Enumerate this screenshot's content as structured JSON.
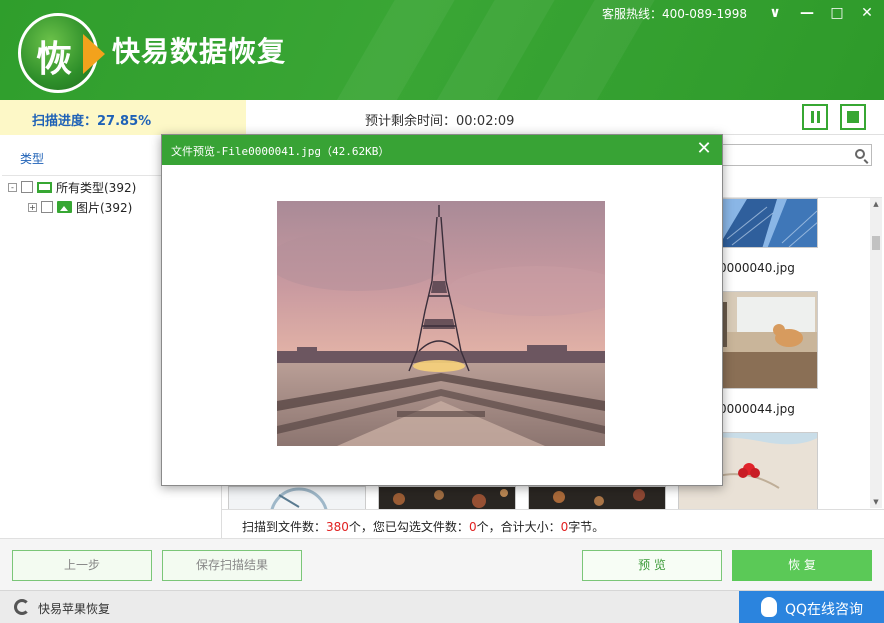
{
  "header": {
    "logo_char": "恢",
    "app_title": "快易数据恢复",
    "hotline": "客服热线：400-089-1998",
    "window_buttons": {
      "menu": "∨",
      "minimize": "—",
      "maximize": "□",
      "close": "✕"
    }
  },
  "scan": {
    "progress_label": "扫描进度：27.85%",
    "progress_fraction": 0.2785,
    "remaining_label": "预计剩余时间：00:02:09"
  },
  "left_panel": {
    "header": "类型",
    "tree": [
      {
        "label": "所有类型(392)",
        "expander": "-",
        "icon": "computer-icon"
      },
      {
        "label": "图片(392)",
        "expander": "+",
        "icon": "image-icon"
      }
    ]
  },
  "grid": {
    "files": [
      {
        "name": "0000040.jpg"
      },
      {
        "name": "0000044.jpg"
      }
    ]
  },
  "status": {
    "prefix": "扫描到文件数：",
    "scanned_count": "380",
    "mid1": "个，您已勾选文件数：",
    "selected_count": "0",
    "mid2": "个，合计大小：",
    "total_size": "0",
    "suffix": "字节。"
  },
  "buttons": {
    "prev": "上一步",
    "save_results": "保存扫描结果",
    "preview": "预 览",
    "recover": "恢 复"
  },
  "footer": {
    "apple_recovery": "快易苹果恢复",
    "qq_consult": "QQ在线咨询"
  },
  "dialog": {
    "title": "文件预览-File0000041.jpg（42.62KB）",
    "close": "✕"
  },
  "colors": {
    "brand_green": "#38a335",
    "link_blue": "#1f62b7",
    "highlight_red": "#e02020",
    "qq_blue": "#2b84de"
  }
}
